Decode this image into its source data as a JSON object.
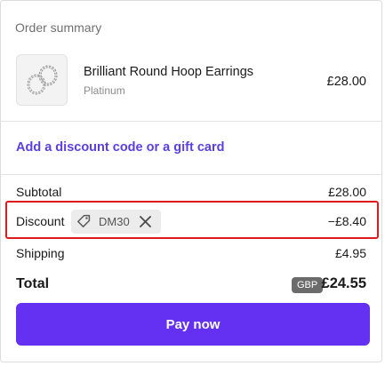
{
  "order_summary": {
    "title": "Order summary",
    "product": {
      "name": "Brilliant Round Hoop Earrings",
      "variant": "Platinum",
      "price": "£28.00",
      "thumbnail_icon": "hoop-earrings-image"
    },
    "discount_link": "Add a discount code or a gift card",
    "subtotal": {
      "label": "Subtotal",
      "value": "£28.00"
    },
    "discount": {
      "label": "Discount",
      "code": "DM30",
      "value": "−£8.40",
      "tag_icon": "tag-icon",
      "remove_icon": "close-icon"
    },
    "shipping": {
      "label": "Shipping",
      "value": "£4.95"
    },
    "total": {
      "label": "Total",
      "currency": "GBP",
      "value": "£24.55"
    },
    "pay_button": "Pay now"
  },
  "colors": {
    "accent": "#6431f2",
    "link": "#5b3fe0",
    "highlight_border": "#e0191b",
    "currency_badge": "#6b6b6b"
  }
}
